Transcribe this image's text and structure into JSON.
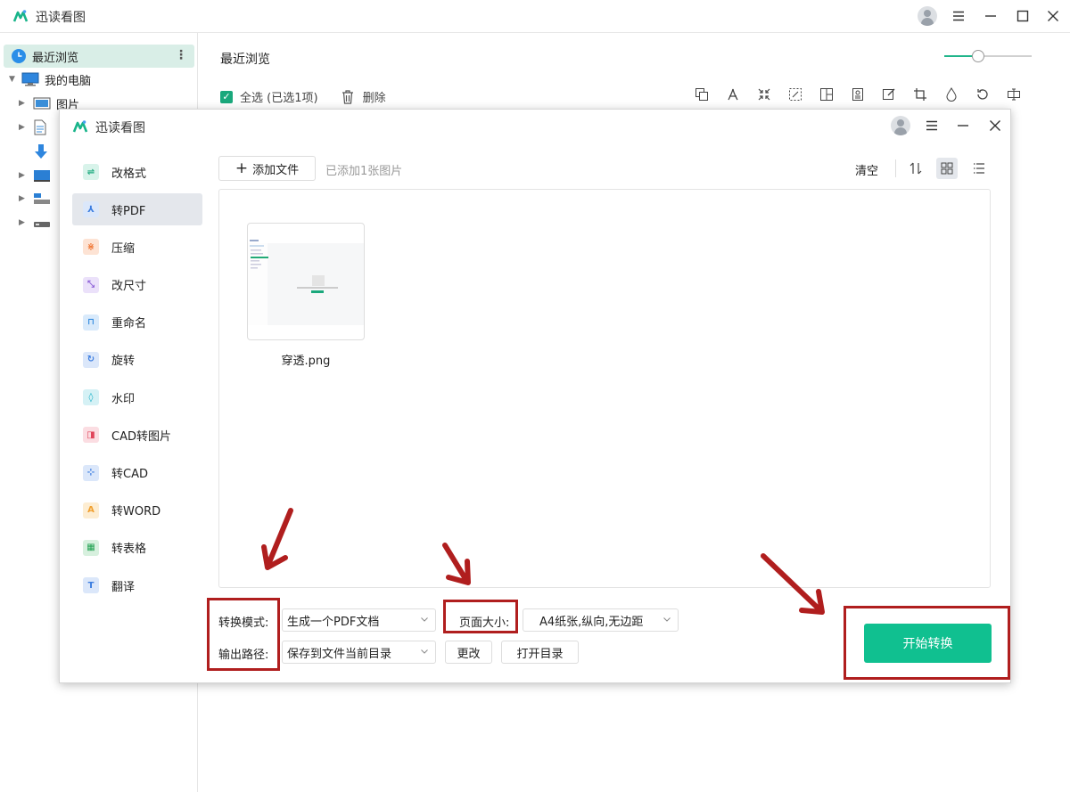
{
  "app": {
    "title": "迅读看图"
  },
  "sidebar": {
    "items": [
      {
        "label": "最近浏览",
        "icon": "clock-icon",
        "selected": true
      },
      {
        "label": "我的电脑",
        "icon": "computer-icon"
      },
      {
        "label": "图片",
        "icon": "picture-folder-icon"
      }
    ]
  },
  "main": {
    "title": "最近浏览",
    "select_all_label": "全选 (已选1项)",
    "delete_label": "删除",
    "zoom_fraction": 0.39
  },
  "dialog": {
    "title": "迅读看图",
    "menu": [
      {
        "label": "改格式",
        "icon": "convert-format-icon",
        "color": "#1aa87c",
        "glyph": "⇌"
      },
      {
        "label": "转PDF",
        "icon": "pdf-icon",
        "color": "#3b7de0",
        "glyph": "⅄",
        "active": true
      },
      {
        "label": "压缩",
        "icon": "compress-icon",
        "color": "#f07a3a",
        "glyph": "⋇"
      },
      {
        "label": "改尺寸",
        "icon": "resize-icon",
        "color": "#8a5cd6",
        "glyph": "⤡"
      },
      {
        "label": "重命名",
        "icon": "rename-icon",
        "color": "#3b8fe0",
        "glyph": "⊓"
      },
      {
        "label": "旋转",
        "icon": "rotate-icon",
        "color": "#3b7de0",
        "glyph": "↻"
      },
      {
        "label": "水印",
        "icon": "watermark-icon",
        "color": "#1ab0c8",
        "glyph": "◊"
      },
      {
        "label": "CAD转图片",
        "icon": "cad-to-image-icon",
        "color": "#e0445a",
        "glyph": "◨"
      },
      {
        "label": "转CAD",
        "icon": "to-cad-icon",
        "color": "#3b7de0",
        "glyph": "⊹"
      },
      {
        "label": "转WORD",
        "icon": "to-word-icon",
        "color": "#f0a030",
        "glyph": "A"
      },
      {
        "label": "转表格",
        "icon": "to-table-icon",
        "color": "#20a050",
        "glyph": "▦"
      },
      {
        "label": "翻译",
        "icon": "translate-icon",
        "color": "#3b7de0",
        "glyph": "T"
      }
    ],
    "add_file_label": "添加文件",
    "add_status": "已添加1张图片",
    "clear_label": "清空",
    "files": [
      {
        "name": "穿透.png"
      }
    ],
    "mode_label": "转换模式:",
    "mode_value": "生成一个PDF文档",
    "page_size_label": "页面大小:",
    "page_size_value": "A4纸张,纵向,无边距",
    "output_label": "输出路径:",
    "output_value": "保存到文件当前目录",
    "change_label": "更改",
    "open_dir_label": "打开目录",
    "start_label": "开始转换"
  },
  "colors": {
    "accent": "#10c090",
    "annotation": "#b01e1e"
  }
}
